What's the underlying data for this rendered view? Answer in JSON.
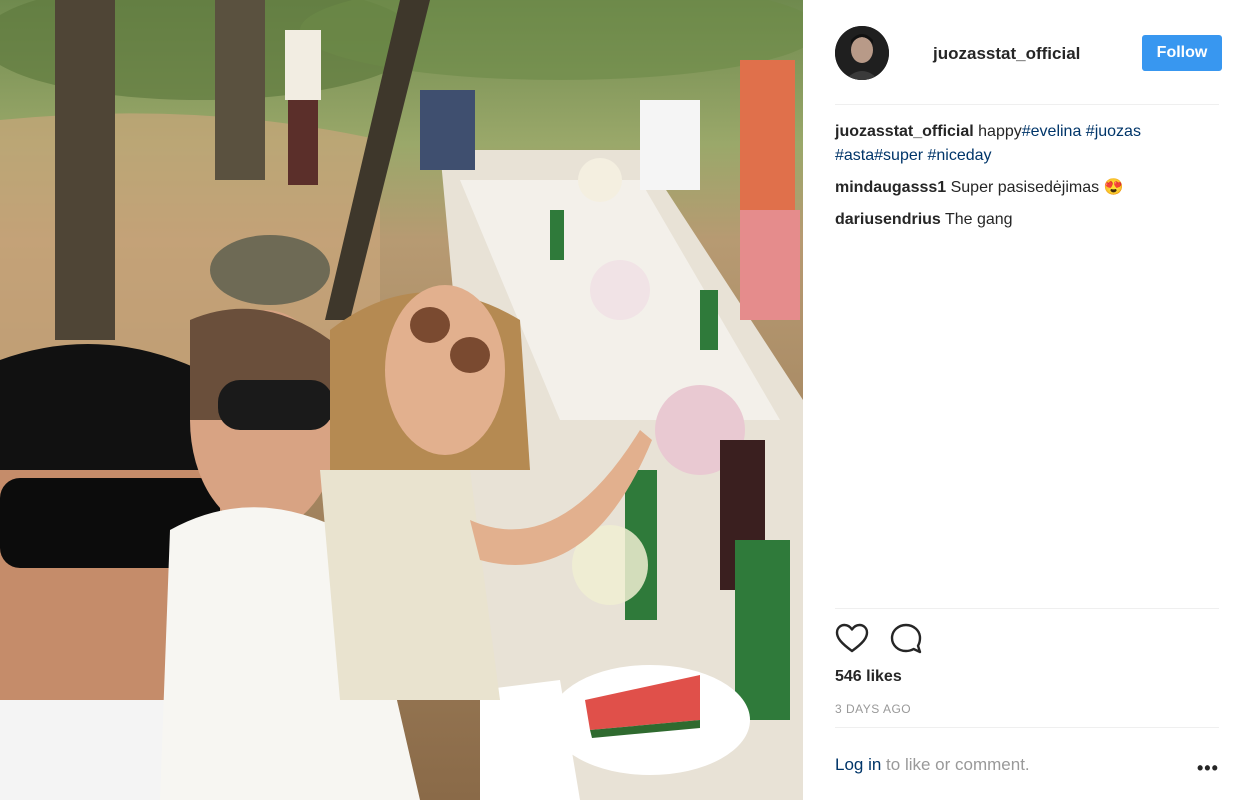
{
  "post": {
    "username": "juozasstat_official",
    "follow_label": "Follow",
    "caption_text": "happy",
    "caption_tags": [
      "#evelina",
      " #juozas",
      "#asta",
      "#super",
      " #niceday"
    ],
    "comments": [
      {
        "user": "mindaugasss1",
        "text": "Super pasisedėjimas 😍"
      },
      {
        "user": "dariusendrius",
        "text": "The gang"
      }
    ],
    "likes": "546 likes",
    "time": "3 DAYS AGO",
    "login_link": "Log in",
    "login_rest": " to like or comment.",
    "more": "•••"
  },
  "icons": {
    "like": "heart-icon",
    "comment": "comment-bubble-icon",
    "more": "more-options-icon"
  },
  "colors": {
    "follow_button": "#3897f0",
    "hashtag": "#003569",
    "muted": "#999999"
  }
}
